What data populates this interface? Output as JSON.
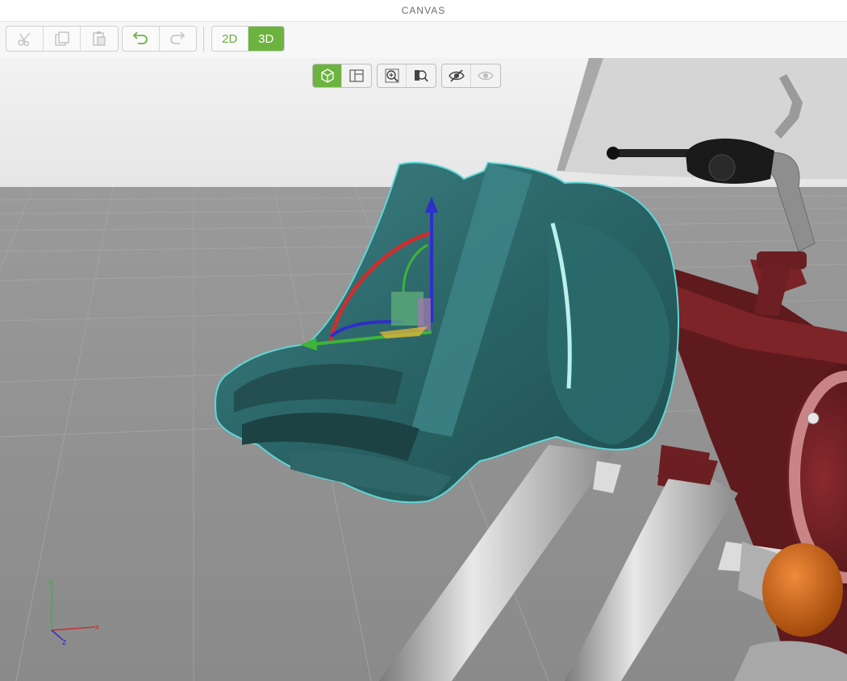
{
  "window": {
    "title": "CANVAS"
  },
  "toolbar": {
    "cut": {
      "icon": "scissors-icon"
    },
    "copy": {
      "icon": "copy-icon"
    },
    "paste": {
      "icon": "paste-icon"
    },
    "undo": {
      "icon": "undo-icon"
    },
    "redo": {
      "icon": "redo-icon"
    },
    "mode_2d_label": "2D",
    "mode_3d_label": "3D",
    "active_mode": "3D"
  },
  "view_tools": {
    "perspective": {
      "icon": "cube-view-icon",
      "active": true
    },
    "orthographic": {
      "icon": "panel-view-icon",
      "active": false
    },
    "zoom_fit": {
      "icon": "zoom-in-icon"
    },
    "zoom_selected": {
      "icon": "zoom-selection-icon"
    },
    "hide_selected": {
      "icon": "eye-hidden-icon"
    },
    "show_all": {
      "icon": "eye-icon"
    }
  },
  "axis_indicator": {
    "x_label": "x",
    "y_label": "y",
    "z_label": "z"
  },
  "colors": {
    "accent": "#6cb33f",
    "selection": "#2e6b6e",
    "frame": "#6b1f22",
    "fork": "#b8b8b8",
    "turn_signal": "#d4660e",
    "gizmo_x": "#3fb33a",
    "gizmo_y": "#2e2ec9",
    "gizmo_z": "#c93030"
  }
}
